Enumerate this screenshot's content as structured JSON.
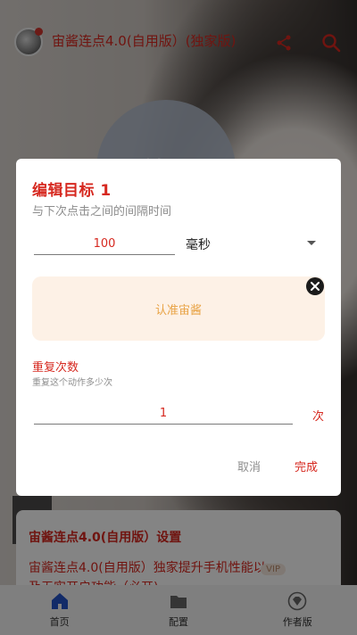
{
  "app": {
    "title": "宙酱连点4.0(自用版）(独家版)",
    "center_button_label": "首页"
  },
  "settings_card": {
    "title": "宙酱连点4.0(自用版）设置",
    "description": "宙酱连点4.0(自用版）独家提升手机性能以及无实开启功能（必开)",
    "badge": "VIP"
  },
  "bottom_nav": {
    "items": [
      {
        "label": "首页",
        "icon": "home-icon",
        "active": true
      },
      {
        "label": "配置",
        "icon": "folder-icon",
        "active": false
      },
      {
        "label": "作者版",
        "icon": "diamond-icon",
        "active": false
      }
    ]
  },
  "dialog": {
    "title": "编辑目标  1",
    "subtitle": "与下次点击之间的间隔时间",
    "interval_value": "100",
    "interval_unit": "毫秒",
    "target_label": "认准宙酱",
    "repeat_title": "重复次数",
    "repeat_desc": "重复这个动作多少次",
    "repeat_value": "1",
    "repeat_unit": "次",
    "cancel_label": "取消",
    "done_label": "完成"
  },
  "colors": {
    "accent_red": "#d6281f",
    "target_bg": "#fdf1e6",
    "target_text": "#e8a243"
  }
}
